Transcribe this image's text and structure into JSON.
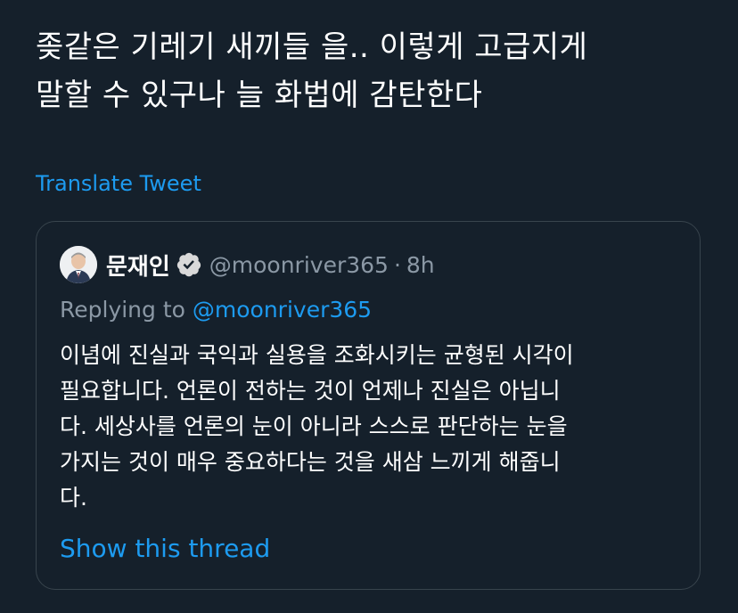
{
  "tweet": {
    "text_lines": [
      "좆같은 기레기 새끼들 을.. 이렇게 고급지게",
      "말할 수 있구나 늘 화법에 감탄한다"
    ],
    "translate_label": "Translate Tweet"
  },
  "quote": {
    "display_name": "문재인",
    "handle": "@moonriver365",
    "separator": "·",
    "timestamp": "8h",
    "replying_prefix": "Replying to ",
    "replying_handle": "@moonriver365",
    "body_lines": [
      "이념에 진실과 국익과 실용을 조화시키는 균형된 시각이",
      "필요합니다. 언론이  전하는 것이 언제나 진실은 아닙니",
      "다. 세상사를 언론의 눈이 아니라 스스로 판단하는 눈을",
      "가지는 것이 매우 중요하다는 것을 새삼 느끼게 해줍니",
      "다."
    ],
    "show_thread_label": "Show this thread",
    "verified_icon": "verified-badge-icon",
    "avatar_icon": "avatar"
  },
  "colors": {
    "background": "#15202b",
    "link": "#1d9bf0",
    "secondary_text": "#8b98a5",
    "border": "#38444d"
  }
}
